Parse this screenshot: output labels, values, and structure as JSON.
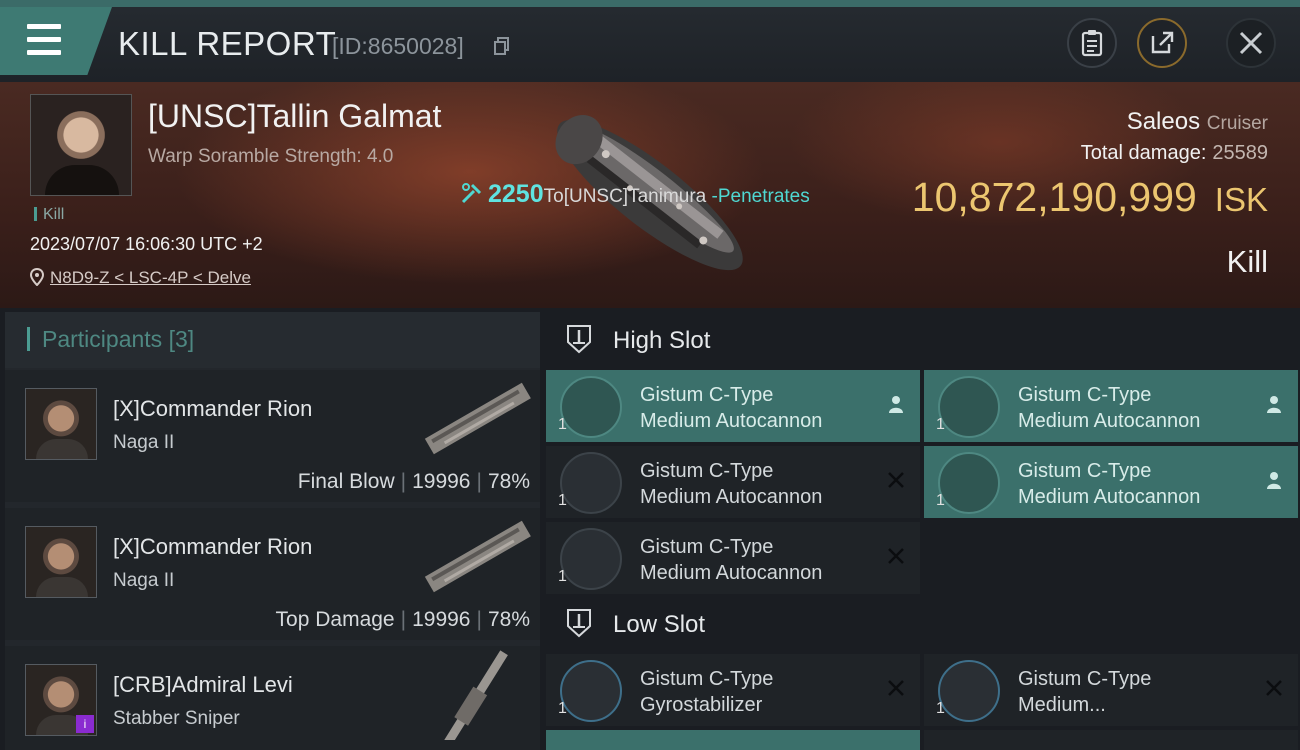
{
  "header": {
    "title": "KILL REPORT",
    "report_id": "[ID:8650028]"
  },
  "victim": {
    "name": "[UNSC]Tallin Galmat",
    "warp_scramble": "Warp Soramble Strength: 4.0",
    "tag": "Kill",
    "timestamp": "2023/07/07 16:06:30 UTC +2",
    "location": "N8D9-Z < LSC-4P < Delve"
  },
  "damage_line": {
    "amount": "2250",
    "target": "To[UNSC]Tanimura",
    "suffix": " -Penetrates"
  },
  "ship": {
    "name": "Saleos",
    "class": "Cruiser",
    "total_damage_label": "Total damage:",
    "total_damage_value": "25589",
    "isk_value": "10,872,190,999",
    "isk_currency": "ISK",
    "result": "Kill"
  },
  "participants": {
    "title": "Participants",
    "count": "[3]",
    "rows": [
      {
        "name": "[X]Commander Rion",
        "ship": "Naga II",
        "role": "Final Blow",
        "damage": "19996",
        "percent": "78%"
      },
      {
        "name": "[X]Commander Rion",
        "ship": "Naga II",
        "role": "Top Damage",
        "damage": "19996",
        "percent": "78%"
      },
      {
        "name": "[CRB]Admiral Levi",
        "ship": "Stabber Sniper"
      }
    ]
  },
  "slots": {
    "high": {
      "title": "High Slot",
      "modules": [
        {
          "line1": "Gistum C-Type",
          "line2": "Medium Autocannon",
          "qty": "1",
          "state": "fitted"
        },
        {
          "line1": "Gistum C-Type",
          "line2": "Medium Autocannon",
          "qty": "1",
          "state": "fitted"
        },
        {
          "line1": "Gistum C-Type",
          "line2": "Medium Autocannon",
          "qty": "1",
          "state": "destroyed"
        },
        {
          "line1": "Gistum C-Type",
          "line2": "Medium Autocannon",
          "qty": "1",
          "state": "fitted"
        },
        {
          "line1": "Gistum C-Type",
          "line2": "Medium Autocannon",
          "qty": "1",
          "state": "destroyed"
        }
      ]
    },
    "low": {
      "title": "Low Slot",
      "modules": [
        {
          "line1": "Gistum C-Type",
          "line2": "Gyrostabilizer",
          "qty": "1",
          "state": "destroyed"
        },
        {
          "line1": "Gistum C-Type",
          "line2": "Medium...",
          "qty": "1",
          "state": "destroyed"
        }
      ]
    }
  },
  "colors": {
    "accent_teal": "#3e7a73",
    "isk_gold": "#ecc670",
    "damage_cyan": "#5fe3e0"
  }
}
